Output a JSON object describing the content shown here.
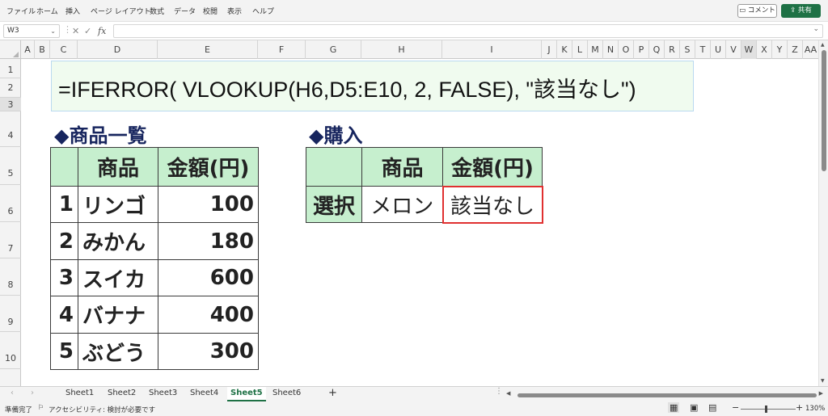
{
  "ribbon": {
    "tabs": [
      "ファイル",
      "ホーム",
      "挿入",
      "ページ レイアウト",
      "数式",
      "データ",
      "校閲",
      "表示",
      "ヘルプ"
    ],
    "comment_label": "コメント",
    "share_label": "共有"
  },
  "formula_bar": {
    "name_box": "W3",
    "fx": "fx",
    "value": ""
  },
  "columns": [
    "A",
    "B",
    "C",
    "D",
    "E",
    "F",
    "G",
    "H",
    "I",
    "J",
    "K",
    "L",
    "M",
    "N",
    "O",
    "P",
    "Q",
    "R",
    "S",
    "T",
    "U",
    "V",
    "W",
    "X",
    "Y",
    "Z",
    "AA"
  ],
  "rows": [
    "1",
    "2",
    "3",
    "4",
    "5",
    "6",
    "7",
    "8",
    "9",
    "10"
  ],
  "sheet": {
    "formula_display": "=IFERROR( VLOOKUP(H6,D5:E10, 2, FALSE), \"該当なし\")",
    "product_list": {
      "heading": "◆商品一覧",
      "header_product": "商品",
      "header_price": "金額(円)",
      "rows": [
        {
          "no": "1",
          "name": "リンゴ",
          "price": "100"
        },
        {
          "no": "2",
          "name": "みかん",
          "price": "180"
        },
        {
          "no": "3",
          "name": "スイカ",
          "price": "600"
        },
        {
          "no": "4",
          "name": "バナナ",
          "price": "400"
        },
        {
          "no": "5",
          "name": "ぶどう",
          "price": "300"
        }
      ]
    },
    "purchase": {
      "heading": "◆購入",
      "header_product": "商品",
      "header_price": "金額(円)",
      "row_label": "選択",
      "selected_product": "メロン",
      "result": "該当なし"
    }
  },
  "sheet_tabs": [
    "Sheet1",
    "Sheet2",
    "Sheet3",
    "Sheet4",
    "Sheet5",
    "Sheet6"
  ],
  "active_sheet": "Sheet5",
  "add_sheet": "+",
  "status": {
    "ready": "準備完了",
    "accessibility": "アクセシビリティ: 検討が必要です",
    "zoom": "130%"
  }
}
